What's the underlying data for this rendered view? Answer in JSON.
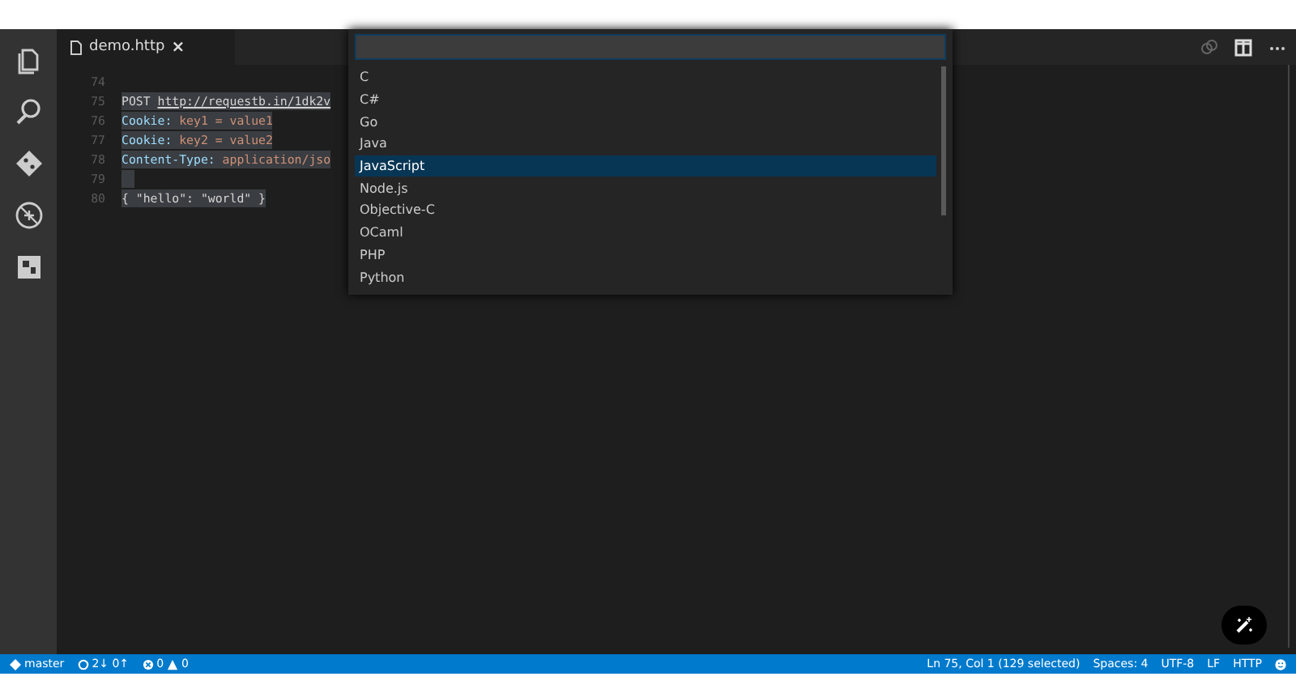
{
  "tabs": [
    {
      "label": "demo.http",
      "selected": true,
      "close": "×"
    }
  ],
  "editor": {
    "lines": [
      {
        "number": "74",
        "selected": false
      },
      {
        "number": "75",
        "selected": true,
        "tokens": [
          {
            "kind": "keyword",
            "text": "POST "
          },
          {
            "kind": "link",
            "text": "http://requestb.in/1dk2v"
          }
        ]
      },
      {
        "number": "76",
        "selected": true,
        "tokens": [
          {
            "kind": "header",
            "text": "Cookie: "
          },
          {
            "kind": "value",
            "text": "key1 = value1"
          }
        ]
      },
      {
        "number": "77",
        "selected": true,
        "tokens": [
          {
            "kind": "header",
            "text": "Cookie: "
          },
          {
            "kind": "value",
            "text": "key2 = value2"
          }
        ]
      },
      {
        "number": "78",
        "selected": true,
        "tokens": [
          {
            "kind": "header",
            "text": "Content-Type: "
          },
          {
            "kind": "value",
            "text": "application/jso"
          }
        ]
      },
      {
        "number": "79",
        "selected": true
      },
      {
        "number": "80",
        "selected": true,
        "tokens": [
          {
            "kind": "plain",
            "text": "{ \"hello\": \"world\" }"
          }
        ]
      }
    ]
  },
  "quick_pick": {
    "items": [
      {
        "label": "C",
        "selected": false
      },
      {
        "label": "C#",
        "selected": false
      },
      {
        "label": "Go",
        "selected": false
      },
      {
        "label": "Java",
        "selected": false
      },
      {
        "label": "JavaScript",
        "selected": true
      },
      {
        "label": "Node.js",
        "selected": false
      },
      {
        "label": "Objective-C",
        "selected": false
      },
      {
        "label": "OCaml",
        "selected": false
      },
      {
        "label": "PHP",
        "selected": false
      },
      {
        "label": "Python",
        "selected": false
      }
    ]
  },
  "status_bar": {
    "branch": "master",
    "sync": "2↓ 0↑",
    "errors": "0",
    "warnings": "0",
    "position": "Ln 75, Col 1 (129 selected)",
    "indent": "Spaces: 4",
    "encoding": "UTF-8",
    "eol": "LF",
    "language": "HTTP"
  }
}
